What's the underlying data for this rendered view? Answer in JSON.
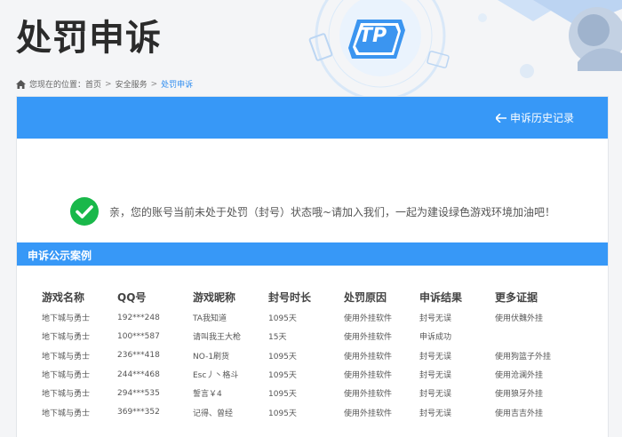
{
  "header": {
    "title": "处罚申诉",
    "logo_text": "TP"
  },
  "breadcrumb": {
    "prefix": "您现在的位置：",
    "items": [
      "首页",
      "安全服务",
      "处罚申诉"
    ],
    "separator": ">"
  },
  "card": {
    "history_link": "申诉历史记录",
    "notice": "亲，您的账号当前未处于处罚（封号）状态哦~请加入我们，一起为建设绿色游戏环境加油吧！",
    "section_title": "申诉公示案例"
  },
  "cases_table": {
    "columns": [
      "游戏名称",
      "QQ号",
      "游戏昵称",
      "封号时长",
      "处罚原因",
      "申诉结果",
      "更多证据"
    ],
    "rows": [
      [
        "地下城与勇士",
        "192***248",
        "TA我知道",
        "1095天",
        "使用外挂软件",
        "封号无误",
        "使用伏魏外挂"
      ],
      [
        "地下城与勇士",
        "100***587",
        "请叫我王大枪",
        "15天",
        "使用外挂软件",
        "申诉成功",
        ""
      ],
      [
        "地下城与勇士",
        "236***418",
        "NO-1刷货",
        "1095天",
        "使用外挂软件",
        "封号无误",
        "使用狗篮子外挂"
      ],
      [
        "地下城与勇士",
        "244***468",
        "Esc丿丶格斗",
        "1095天",
        "使用外挂软件",
        "封号无误",
        "使用沧澜外挂"
      ],
      [
        "地下城与勇士",
        "294***535",
        "誓言￥4",
        "1095天",
        "使用外挂软件",
        "封号无误",
        "使用狼牙外挂"
      ],
      [
        "地下城与勇士",
        "369***352",
        "记得、曾经",
        "1095天",
        "使用外挂软件",
        "封号无误",
        "使用吉吉外挂"
      ]
    ]
  },
  "icons": {
    "home": "home-icon",
    "back_arrow": "arrow-left-icon",
    "success": "check-circle-icon"
  },
  "colors": {
    "accent": "#3798f7",
    "success": "#19b84a",
    "breadcrumb_current": "#2d8cf0"
  }
}
